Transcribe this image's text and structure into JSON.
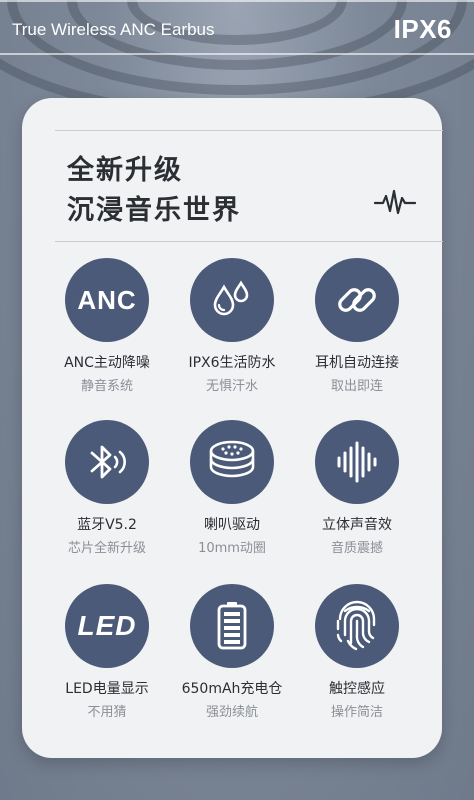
{
  "header": {
    "brand": "True Wireless ANC Earbus",
    "rating": "IPX6"
  },
  "card": {
    "headline_1": "全新升级",
    "headline_2": "沉浸音乐世界"
  },
  "features": [
    {
      "title": "ANC主动降噪",
      "subtitle": "静音系统",
      "icon": "anc-icon",
      "icon_text": "ANC"
    },
    {
      "title": "IPX6生活防水",
      "subtitle": "无惧汗水",
      "icon": "water-drops-icon"
    },
    {
      "title": "耳机自动连接",
      "subtitle": "取出即连",
      "icon": "link-icon"
    },
    {
      "title": "蓝牙V5.2",
      "subtitle": "芯片全新升级",
      "icon": "bluetooth-icon"
    },
    {
      "title": "喇叭驱动",
      "subtitle": "10mm动圈",
      "icon": "speaker-driver-icon"
    },
    {
      "title": "立体声音效",
      "subtitle": "音质震撼",
      "icon": "soundwave-icon"
    },
    {
      "title": "LED电量显示",
      "subtitle": "不用猜",
      "icon": "led-icon",
      "icon_text": "LED"
    },
    {
      "title": "650mAh充电仓",
      "subtitle": "强劲续航",
      "icon": "battery-icon"
    },
    {
      "title": "触控感应",
      "subtitle": "操作简洁",
      "icon": "fingerprint-icon"
    }
  ],
  "colors": {
    "icon_bg": "#4b5a78",
    "card_bg": "#f1f2f4",
    "page_bg": "#7d8898"
  }
}
